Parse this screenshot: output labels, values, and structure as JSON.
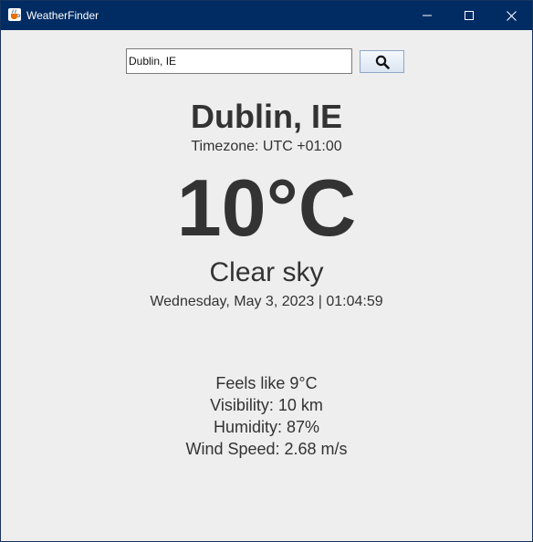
{
  "window": {
    "title": "WeatherFinder",
    "titlebar_color": "#002c63",
    "background_color": "#eeeeee"
  },
  "search": {
    "value": "Dublin, IE",
    "button_icon": "search-icon"
  },
  "weather": {
    "city": "Dublin, IE",
    "timezone": "Timezone: UTC +01:00",
    "temperature": "10°C",
    "description": "Clear sky",
    "datetime": "Wednesday, May 3, 2023 | 01:04:59",
    "feels_like": "Feels like 9°C",
    "visibility": "Visibility: 10 km",
    "humidity": "Humidity: 87%",
    "wind_speed": "Wind Speed: 2.68 m/s"
  },
  "text_color": "#333333"
}
